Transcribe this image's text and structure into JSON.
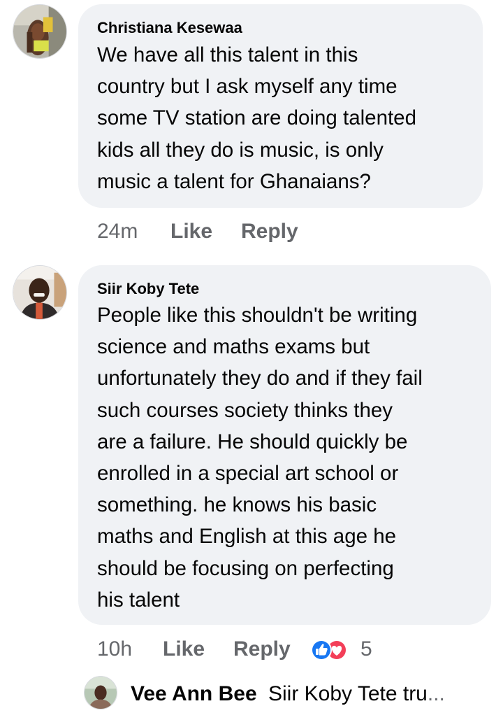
{
  "comments": [
    {
      "author": "Christiana Kesewaa",
      "text": "We have all this talent in this\ncountry but I ask myself any time\nsome TV station are doing talented\nkids all they do is music,  is only\nmusic a talent for Ghanaians?",
      "time": "24m",
      "like_label": "Like",
      "reply_label": "Reply"
    },
    {
      "author": "Siir Koby Tete",
      "text": "People like this shouldn't be writing\nscience and maths exams but\nunfortunately they do and if they fail\nsuch courses society thinks they\nare a failure. He should quickly be\nenrolled in a special art school or\nsomething. he knows his basic\nmaths and English at this age he\nshould be focusing on perfecting\nhis talent",
      "time": "10h",
      "like_label": "Like",
      "reply_label": "Reply",
      "reaction_icons": [
        "like-reaction-icon",
        "love-reaction-icon"
      ],
      "reaction_count": "5"
    }
  ],
  "reply_preview": {
    "author": "Vee Ann Bee",
    "snippet": "Siir Koby Tete tru",
    "ellipsis": "..."
  },
  "colors": {
    "bubble": "#f0f2f5",
    "meta_text": "#65676b",
    "like_blue": "#1877f2",
    "love_red": "#f33e58"
  }
}
